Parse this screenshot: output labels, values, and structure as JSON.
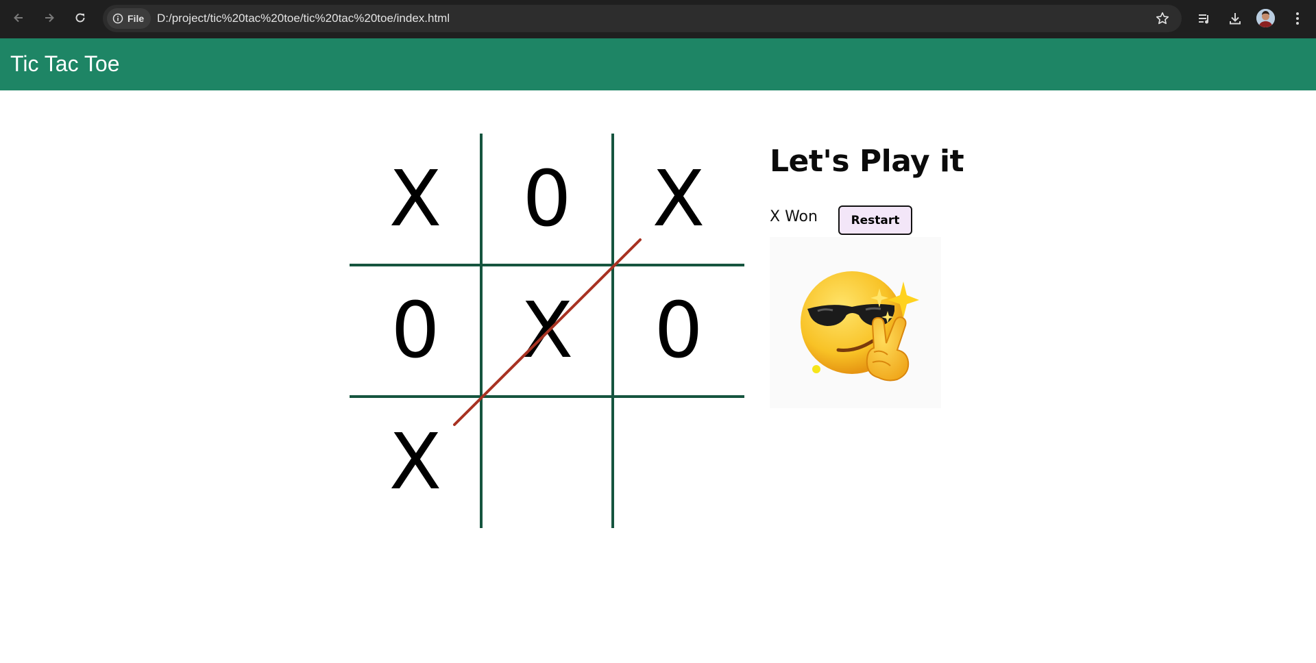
{
  "browser": {
    "site_chip_label": "File",
    "url": "D:/project/tic%20tac%20toe/tic%20tac%20toe/index.html",
    "icons": [
      "back-arrow-icon",
      "forward-arrow-icon",
      "reload-icon",
      "info-icon",
      "star-icon",
      "media-icon",
      "download-icon",
      "avatar",
      "menu-icon"
    ]
  },
  "app": {
    "title": "Tic Tac Toe"
  },
  "board": {
    "cells": [
      "X",
      "0",
      "X",
      "0",
      "X",
      "0",
      "X",
      "",
      ""
    ],
    "winning_cells": [
      2,
      4,
      6
    ]
  },
  "panel": {
    "title": "Let's Play it",
    "status": "X Won",
    "restart_label": "Restart",
    "image_icon": "cool-emoji-sunglasses-peace"
  },
  "colors": {
    "header_bg": "#1e8565",
    "grid_line": "#16553f",
    "win_line": "#a83222",
    "restart_bg": "#f3e6f8"
  }
}
